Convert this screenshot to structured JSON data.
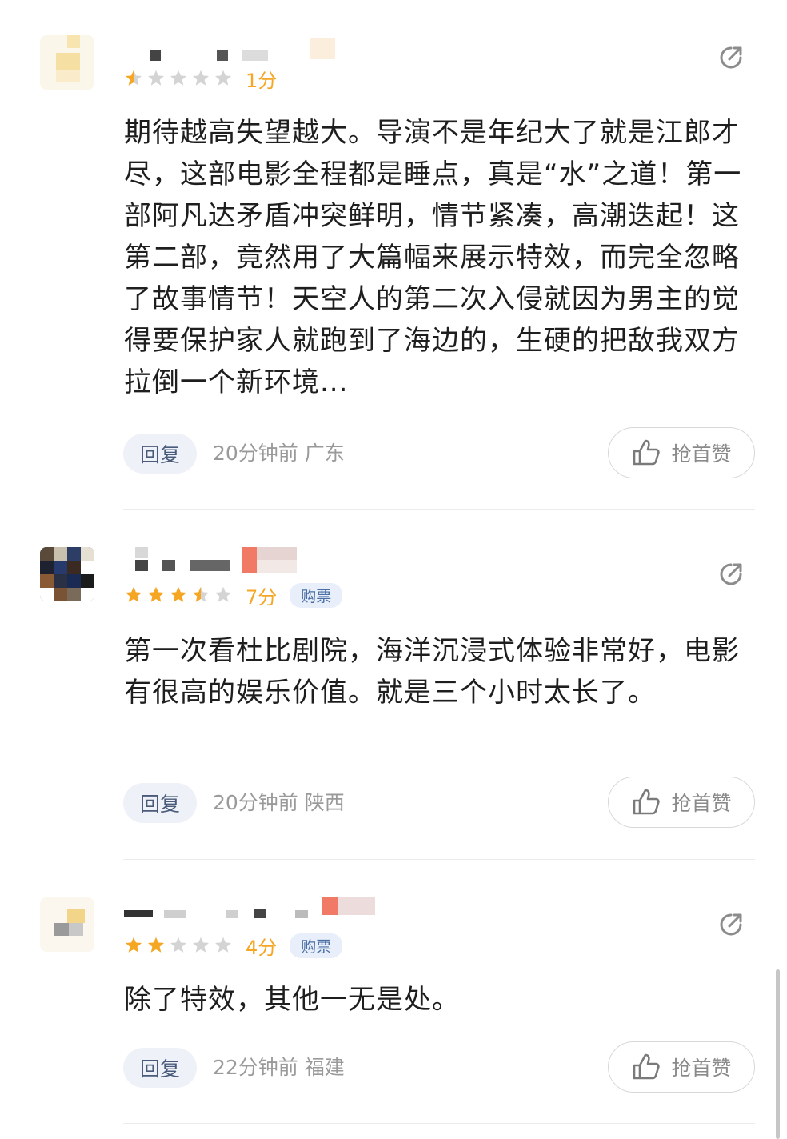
{
  "comments": [
    {
      "stars": 0.5,
      "score": "1分",
      "badge": "",
      "text": "期待越高失望越大。导演不是年纪大了就是江郎才尽，这部电影全程都是睡点，真是“水”之道！第一部阿凡达矛盾冲突鲜明，情节紧凑，高潮迭起！这第二部，竟然用了大篇幅来展示特效，而完全忽略了故事情节！天空人的第二次入侵就因为男主的觉得要保护家人就跑到了海边的，生硬的把敌我双方拉倒一个新环境...",
      "reply_label": "回复",
      "time": "20分钟前",
      "region": "广东",
      "like_label": "抢首赞"
    },
    {
      "stars": 3.5,
      "score": "7分",
      "badge": "购票",
      "text": "第一次看杜比剧院，海洋沉浸式体验非常好，电影有很高的娱乐价值。就是三个小时太长了。",
      "reply_label": "回复",
      "time": "20分钟前",
      "region": "陕西",
      "like_label": "抢首赞"
    },
    {
      "stars": 2,
      "score": "4分",
      "badge": "购票",
      "text": "除了特效，其他一无是处。",
      "reply_label": "回复",
      "time": "22分钟前",
      "region": "福建",
      "like_label": "抢首赞"
    }
  ],
  "colors": {
    "star_on": "#f5a623",
    "star_off": "#d4d4d4",
    "accent_text": "#4a5a7a",
    "meta_text": "#9a9a9a"
  }
}
